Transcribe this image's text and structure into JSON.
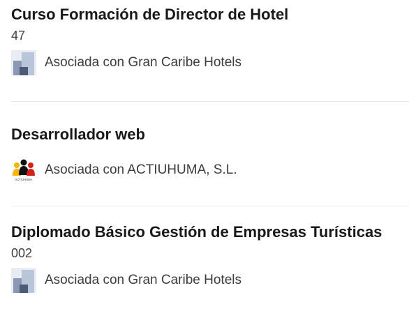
{
  "entries": [
    {
      "title": "Curso Formación de Director de Hotel",
      "subtitle": "47",
      "association": "Asociada con Gran Caribe Hotels",
      "logo_icon": "gran-caribe-logo-icon"
    },
    {
      "title": "Desarrollador web",
      "subtitle": "",
      "association": "Asociada con ACTIUHUMA, S.L.",
      "logo_icon": "actiuhuma-logo-icon",
      "logo_text": "ACTIUHUMA"
    },
    {
      "title": "Diplomado Básico Gestión de Empresas Turísticas",
      "subtitle": "002",
      "association": "Asociada con Gran Caribe Hotels",
      "logo_icon": "gran-caribe-logo-icon"
    }
  ],
  "colors": {
    "title": "#191919",
    "text": "#3d3d3d",
    "divider": "#e8e8e8",
    "gran_caribe_dark": "#4d5b78",
    "gran_caribe_light": "#b9c5d9",
    "actiuhuma_red": "#d6201b",
    "actiuhuma_yellow": "#f4b400"
  }
}
